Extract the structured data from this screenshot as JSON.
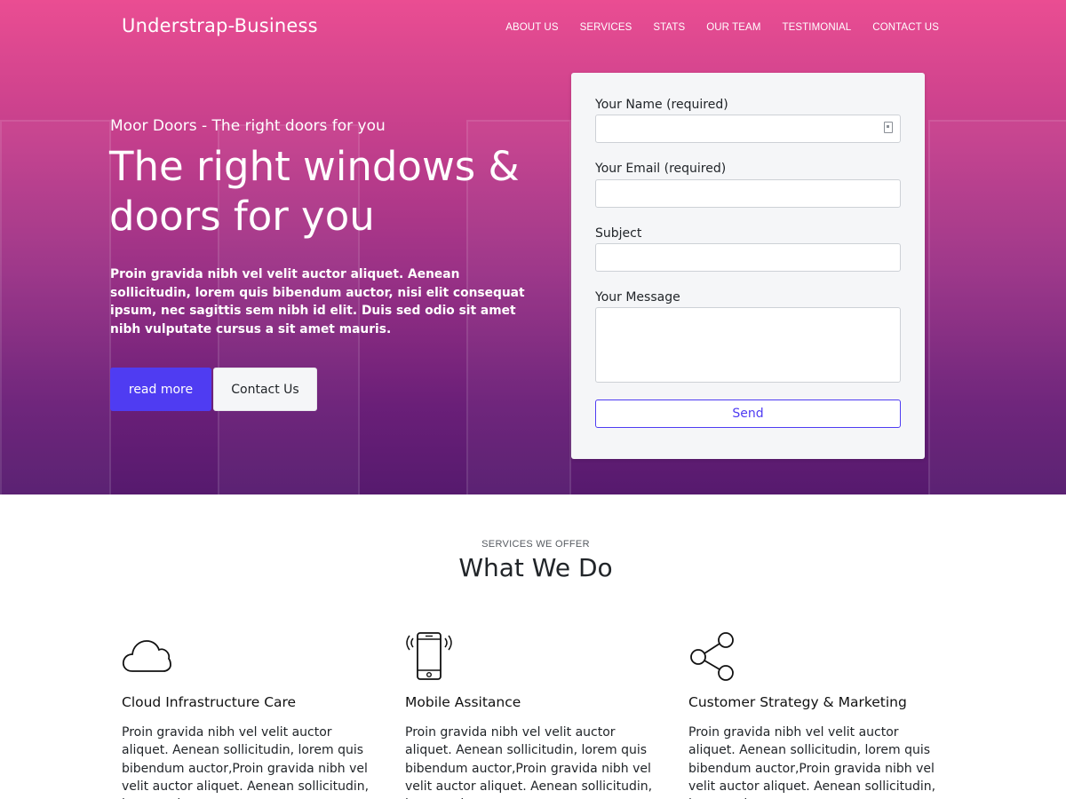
{
  "header": {
    "brand": "Understrap-Business",
    "nav": [
      "ABOUT US",
      "SERVICES",
      "STATS",
      "OUR TEAM",
      "TESTIMONIAL",
      "CONTACT US"
    ]
  },
  "hero": {
    "subtitle": "Moor Doors - The right doors for you",
    "title": "The right windows & doors for you",
    "text": "Proin gravida nibh vel velit auctor aliquet. Aenean sollicitudin, lorem quis bibendum auctor, nisi elit consequat ipsum, nec sagittis sem nibh id elit. Duis sed odio sit amet nibh vulputate cursus a sit amet mauris.",
    "primary_button": "read more",
    "secondary_button": "Contact Us"
  },
  "form": {
    "name_label": "Your Name (required)",
    "email_label": "Your Email (required)",
    "subject_label": "Subject",
    "message_label": "Your Message",
    "name_value": "",
    "email_value": "",
    "subject_value": "",
    "message_value": "",
    "send_label": "Send"
  },
  "services": {
    "kicker": "SERVICES WE OFFER",
    "title": "What We Do",
    "items": [
      {
        "icon": "cloud-icon",
        "title": "Cloud Infrastructure Care",
        "text": "Proin gravida nibh vel velit auctor aliquet. Aenean sollicitudin, lorem quis bibendum auctor,Proin gravida nibh vel velit auctor aliquet. Aenean sollicitudin, lorem quis"
      },
      {
        "icon": "smartphone-icon",
        "title": "Mobile Assitance",
        "text": "Proin gravida nibh vel velit auctor aliquet. Aenean sollicitudin, lorem quis bibendum auctor,Proin gravida nibh vel velit auctor aliquet. Aenean sollicitudin, lorem quis"
      },
      {
        "icon": "share-icon",
        "title": "Customer Strategy & Marketing",
        "text": "Proin gravida nibh vel velit auctor aliquet. Aenean sollicitudin, lorem quis bibendum auctor,Proin gravida nibh vel velit auctor aliquet. Aenean sollicitudin, lorem quis"
      }
    ]
  },
  "colors": {
    "accent": "#4f3cf2",
    "hero_top": "#ea4d92",
    "hero_bottom": "#561a6e"
  }
}
